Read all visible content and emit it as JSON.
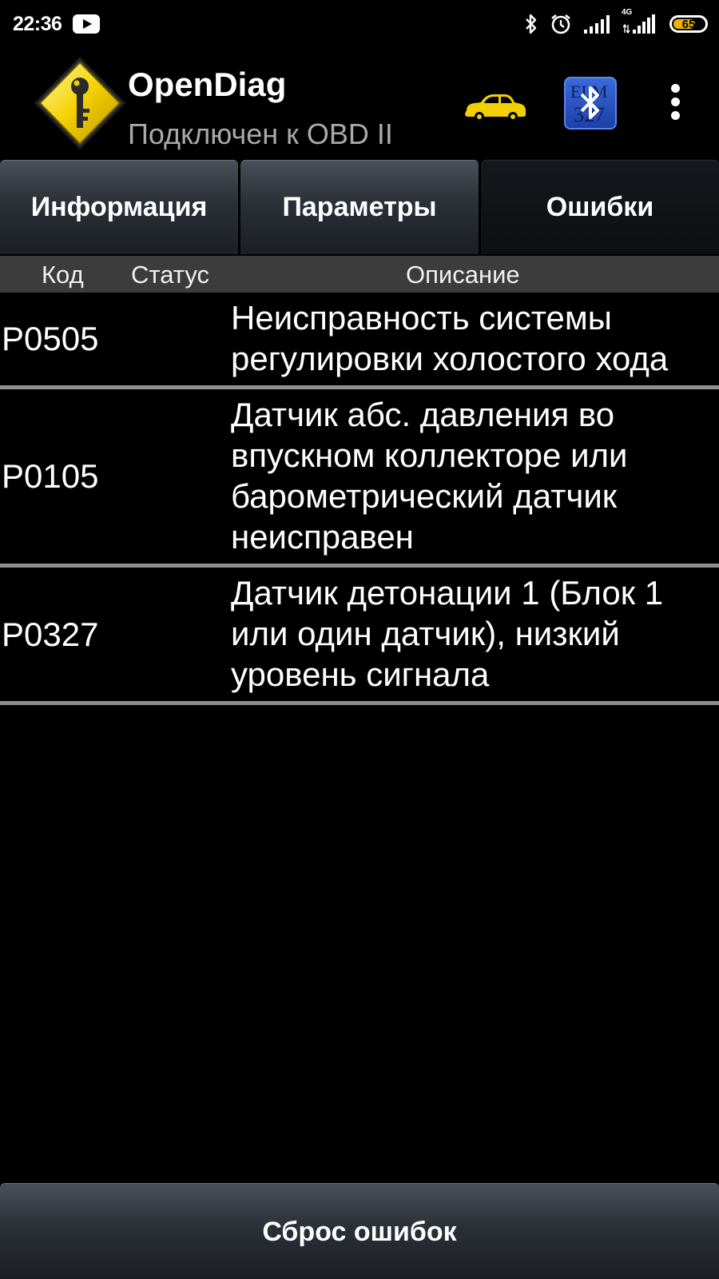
{
  "status_bar": {
    "time": "22:36",
    "battery_level": "65",
    "icons": [
      "youtube-icon",
      "bluetooth-icon",
      "alarm-icon",
      "signal-icon",
      "signal-4g-icon",
      "battery-icon"
    ],
    "signal_4g_label": "4G"
  },
  "app": {
    "title": "OpenDiag",
    "subtitle": "Подключен к OBD II",
    "logo_icon": "key-warning-icon",
    "car_icon": "car-icon",
    "bluetooth_button_icon": "bluetooth-elm327-icon",
    "menu_icon": "more-vert-icon",
    "bluetooth_bg_text": "ELM\n327"
  },
  "tabs": [
    {
      "label": "Информация",
      "active": false
    },
    {
      "label": "Параметры",
      "active": false
    },
    {
      "label": "Ошибки",
      "active": true
    }
  ],
  "table": {
    "headers": {
      "code": "Код",
      "status": "Статус",
      "description": "Описание"
    },
    "rows": [
      {
        "code": "P0505",
        "status": "",
        "description": "Неисправность системы регулировки холостого хода"
      },
      {
        "code": "P0105",
        "status": "",
        "description": "Датчик абс. давления во впускном коллекторе или барометрический датчик неисправен"
      },
      {
        "code": "P0327",
        "status": "",
        "description": "Датчик детонации 1 (Блок 1 или один датчик), низкий уровень сигнала"
      }
    ]
  },
  "reset_button": {
    "label": "Сброс ошибок"
  },
  "colors": {
    "background": "#000000",
    "battery_fill": "#f0b400",
    "logo_yellow": "#f5d000",
    "car_yellow": "#f2cf00",
    "bluetooth_blue": "#2a55c8",
    "subtitle_gray": "#a9a9a9",
    "header_row_bg": "#3c3c3c",
    "row_divider": "#8f8f8f"
  }
}
